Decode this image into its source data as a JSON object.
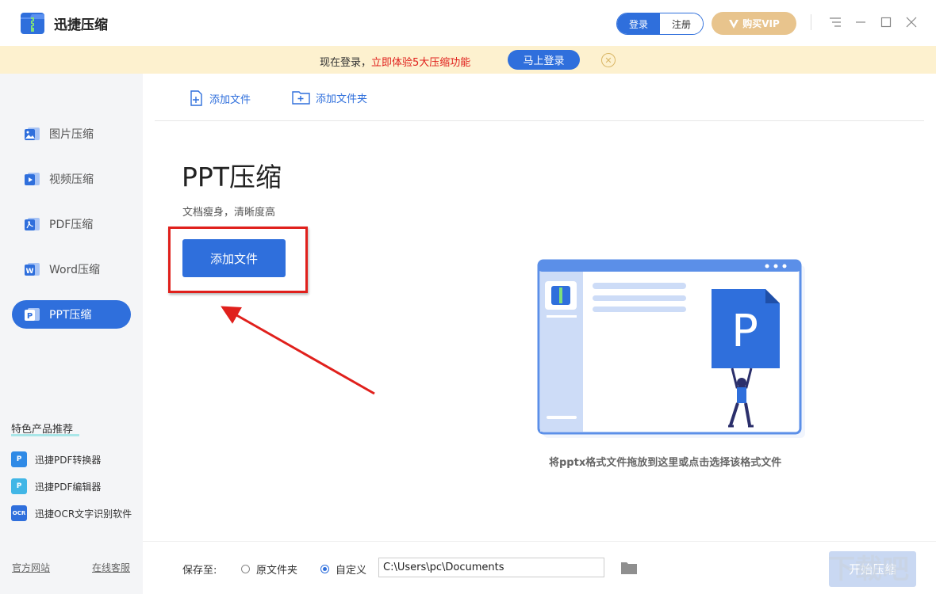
{
  "app": {
    "title": "迅捷压缩",
    "icons": {
      "logo": "zip-folder-icon",
      "menu": "hamburger-icon",
      "minimize": "minimize-icon",
      "maximize": "maximize-icon",
      "close": "close-icon"
    }
  },
  "header": {
    "login_label": "登录",
    "register_label": "注册",
    "vip_label": "购买VIP"
  },
  "notice": {
    "text_prefix": "现在登录，",
    "text_highlight": "立即体验5大压缩功能",
    "button_label": "马上登录",
    "close_symbol": "✕"
  },
  "sidebar": {
    "items": [
      {
        "label": "图片压缩",
        "icon": "image-icon",
        "active": false
      },
      {
        "label": "视频压缩",
        "icon": "video-icon",
        "active": false
      },
      {
        "label": "PDF压缩",
        "icon": "pdf-icon",
        "active": false
      },
      {
        "label": "Word压缩",
        "icon": "word-icon",
        "active": false
      },
      {
        "label": "PPT压缩",
        "icon": "ppt-icon",
        "active": true
      }
    ],
    "featured_title": "特色产品推荐",
    "featured": [
      {
        "label": "迅捷PDF转换器",
        "icon": "pdf-converter-icon",
        "glyph": "P"
      },
      {
        "label": "迅捷PDF编辑器",
        "icon": "pdf-editor-icon",
        "glyph": "P"
      },
      {
        "label": "迅捷OCR文字识别软件",
        "icon": "ocr-icon",
        "glyph": "OCR"
      }
    ],
    "website_link": "官方网站",
    "support_link": "在线客服"
  },
  "toolbar": {
    "add_file_label": "添加文件",
    "add_folder_label": "添加文件夹"
  },
  "main": {
    "title": "PPT压缩",
    "subtitle": "文档瘦身，清晰度高",
    "add_file_button": "添加文件",
    "drop_hint": "将pptx格式文件拖放到这里或点击选择该格式文件",
    "illustration_letter": "P"
  },
  "bottom": {
    "save_label": "保存至:",
    "option_original": "原文件夹",
    "option_custom": "自定义",
    "selected_option": "自定义",
    "path_value": "C:\\Users\\pc\\Documents",
    "start_button": "开始压缩"
  },
  "colors": {
    "accent": "#2f6fdc",
    "notice_bg": "#fdf1cf",
    "highlight_red": "#e0201c",
    "vip_gold": "#e8c48d"
  }
}
